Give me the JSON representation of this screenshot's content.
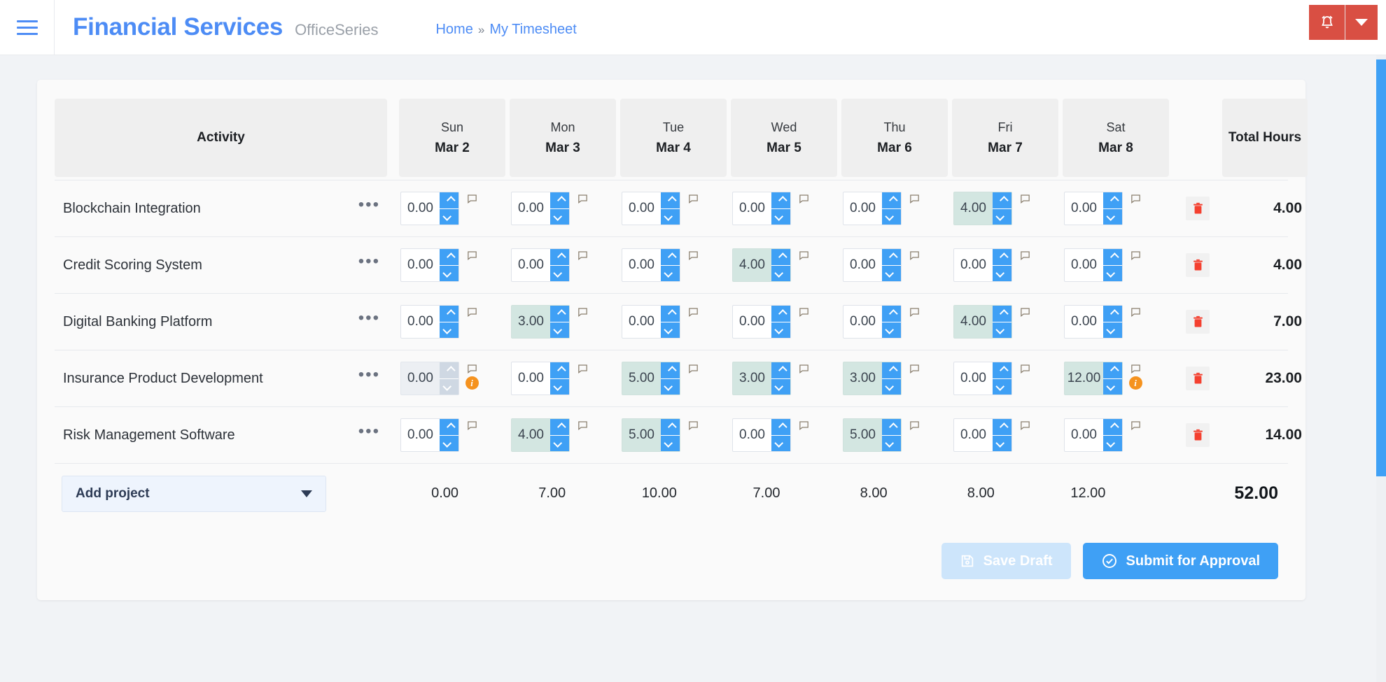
{
  "topbar": {
    "menu_icon": "hamburger-icon",
    "brand": "Financial Services",
    "brand_suffix": "OfficeSeries",
    "breadcrumb": {
      "home": "Home",
      "separator": "»",
      "current": "My Timesheet"
    },
    "notification_icon": "bell-icon",
    "notification_caret_icon": "chevron-down-icon",
    "notification_color": "#d94f43"
  },
  "table": {
    "activity_header": "Activity",
    "total_header": "Total Hours",
    "days": [
      {
        "dow": "Sun",
        "date": "Mar 2"
      },
      {
        "dow": "Mon",
        "date": "Mar 3"
      },
      {
        "dow": "Tue",
        "date": "Mar 4"
      },
      {
        "dow": "Wed",
        "date": "Mar 5"
      },
      {
        "dow": "Thu",
        "date": "Mar 6"
      },
      {
        "dow": "Fri",
        "date": "Mar 7"
      },
      {
        "dow": "Sat",
        "date": "Mar 8"
      }
    ],
    "row_menu_icon": "ellipsis-icon",
    "comment_icon": "comment-icon",
    "warning_icon": "info-badge-icon",
    "delete_icon": "trash-icon",
    "rows": [
      {
        "activity": "Blockchain Integration",
        "cells": [
          {
            "value": "0.00",
            "filled": false,
            "disabled": false,
            "warning": false
          },
          {
            "value": "0.00",
            "filled": false,
            "disabled": false,
            "warning": false
          },
          {
            "value": "0.00",
            "filled": false,
            "disabled": false,
            "warning": false
          },
          {
            "value": "0.00",
            "filled": false,
            "disabled": false,
            "warning": false
          },
          {
            "value": "0.00",
            "filled": false,
            "disabled": false,
            "warning": false
          },
          {
            "value": "4.00",
            "filled": true,
            "disabled": false,
            "warning": false
          },
          {
            "value": "0.00",
            "filled": false,
            "disabled": false,
            "warning": false
          }
        ],
        "total": "4.00"
      },
      {
        "activity": "Credit Scoring System",
        "cells": [
          {
            "value": "0.00",
            "filled": false,
            "disabled": false,
            "warning": false
          },
          {
            "value": "0.00",
            "filled": false,
            "disabled": false,
            "warning": false
          },
          {
            "value": "0.00",
            "filled": false,
            "disabled": false,
            "warning": false
          },
          {
            "value": "4.00",
            "filled": true,
            "disabled": false,
            "warning": false
          },
          {
            "value": "0.00",
            "filled": false,
            "disabled": false,
            "warning": false
          },
          {
            "value": "0.00",
            "filled": false,
            "disabled": false,
            "warning": false
          },
          {
            "value": "0.00",
            "filled": false,
            "disabled": false,
            "warning": false
          }
        ],
        "total": "4.00"
      },
      {
        "activity": "Digital Banking Platform",
        "cells": [
          {
            "value": "0.00",
            "filled": false,
            "disabled": false,
            "warning": false
          },
          {
            "value": "3.00",
            "filled": true,
            "disabled": false,
            "warning": false
          },
          {
            "value": "0.00",
            "filled": false,
            "disabled": false,
            "warning": false
          },
          {
            "value": "0.00",
            "filled": false,
            "disabled": false,
            "warning": false
          },
          {
            "value": "0.00",
            "filled": false,
            "disabled": false,
            "warning": false
          },
          {
            "value": "4.00",
            "filled": true,
            "disabled": false,
            "warning": false
          },
          {
            "value": "0.00",
            "filled": false,
            "disabled": false,
            "warning": false
          }
        ],
        "total": "7.00"
      },
      {
        "activity": "Insurance Product Development",
        "cells": [
          {
            "value": "0.00",
            "filled": false,
            "disabled": true,
            "warning": true
          },
          {
            "value": "0.00",
            "filled": false,
            "disabled": false,
            "warning": false
          },
          {
            "value": "5.00",
            "filled": true,
            "disabled": false,
            "warning": false
          },
          {
            "value": "3.00",
            "filled": true,
            "disabled": false,
            "warning": false
          },
          {
            "value": "3.00",
            "filled": true,
            "disabled": false,
            "warning": false
          },
          {
            "value": "0.00",
            "filled": false,
            "disabled": false,
            "warning": false
          },
          {
            "value": "12.00",
            "filled": true,
            "disabled": false,
            "warning": true
          }
        ],
        "total": "23.00"
      },
      {
        "activity": "Risk Management Software",
        "cells": [
          {
            "value": "0.00",
            "filled": false,
            "disabled": false,
            "warning": false
          },
          {
            "value": "4.00",
            "filled": true,
            "disabled": false,
            "warning": false
          },
          {
            "value": "5.00",
            "filled": true,
            "disabled": false,
            "warning": false
          },
          {
            "value": "0.00",
            "filled": false,
            "disabled": false,
            "warning": false
          },
          {
            "value": "5.00",
            "filled": true,
            "disabled": false,
            "warning": false
          },
          {
            "value": "0.00",
            "filled": false,
            "disabled": false,
            "warning": false
          },
          {
            "value": "0.00",
            "filled": false,
            "disabled": false,
            "warning": false
          }
        ],
        "total": "14.00"
      }
    ],
    "footer": {
      "add_project_label": "Add project",
      "add_project_caret_icon": "chevron-down-icon",
      "day_totals": [
        "0.00",
        "7.00",
        "10.00",
        "7.00",
        "8.00",
        "8.00",
        "12.00"
      ],
      "grand_total": "52.00"
    }
  },
  "actions": {
    "save_draft_label": "Save Draft",
    "save_draft_icon": "save-icon",
    "save_draft_disabled": true,
    "submit_label": "Submit for Approval",
    "submit_icon": "check-circle-icon"
  },
  "colors": {
    "brand_blue": "#4d8cf5",
    "accent_blue": "#3fa0f5",
    "filled_cell": "#d3e6e1",
    "warning_orange": "#f5921e",
    "danger_red": "#d94f43",
    "delete_red": "#f4402f"
  }
}
